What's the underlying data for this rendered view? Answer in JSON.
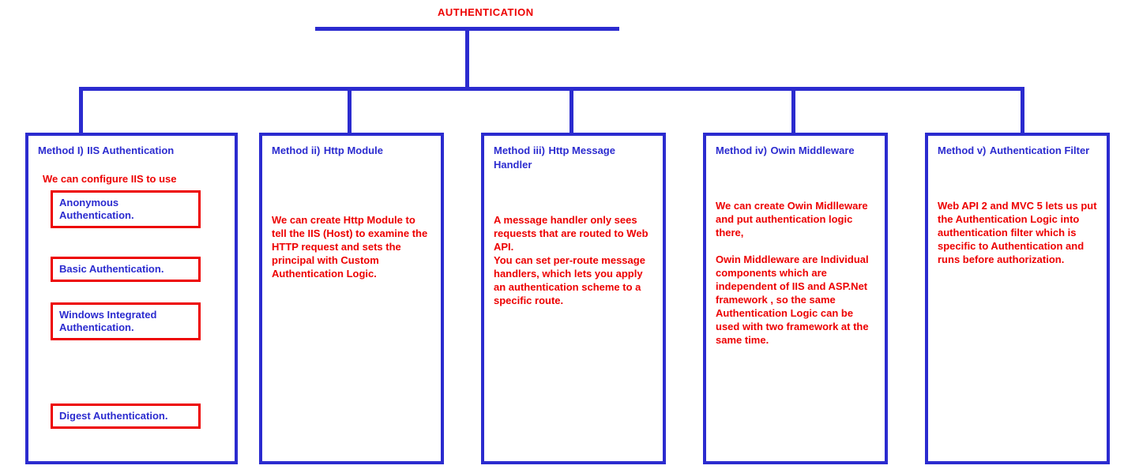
{
  "title": "AUTHENTICATION",
  "colors": {
    "blue": "#2b2bcf",
    "red": "#ed0000"
  },
  "methods": [
    {
      "label": "Method I)",
      "name": "IIS Authentication",
      "intro": "We can configure IIS to use",
      "items": [
        "Anonymous Authentication.",
        "Basic Authentication.",
        "Windows Integrated Authentication.",
        "Digest Authentication."
      ]
    },
    {
      "label": "Method ii)",
      "name": "Http Module",
      "body": "We can create Http Module to tell the IIS (Host) to examine the HTTP request and sets the principal with Custom Authentication Logic."
    },
    {
      "label": "Method iii)",
      "name": "Http Message Handler",
      "body": "A message handler only sees requests that are routed to Web API.\nYou can set per-route message handlers, which lets you apply an authentication scheme to a specific route."
    },
    {
      "label": "Method iv)",
      "name": "Owin Middleware",
      "body": "We can create Owin Midlleware and put authentication logic there,\n\nOwin Middleware are Individual components which are independent of IIS and ASP.Net framework , so the same Authentication Logic can be used with two framework at the same time."
    },
    {
      "label": "Method v)",
      "name": "Authentication Filter",
      "body": " Web API 2 and MVC 5 lets us put the Authentication Logic into authentication filter which is specific to Authentication and runs before authorization."
    }
  ]
}
